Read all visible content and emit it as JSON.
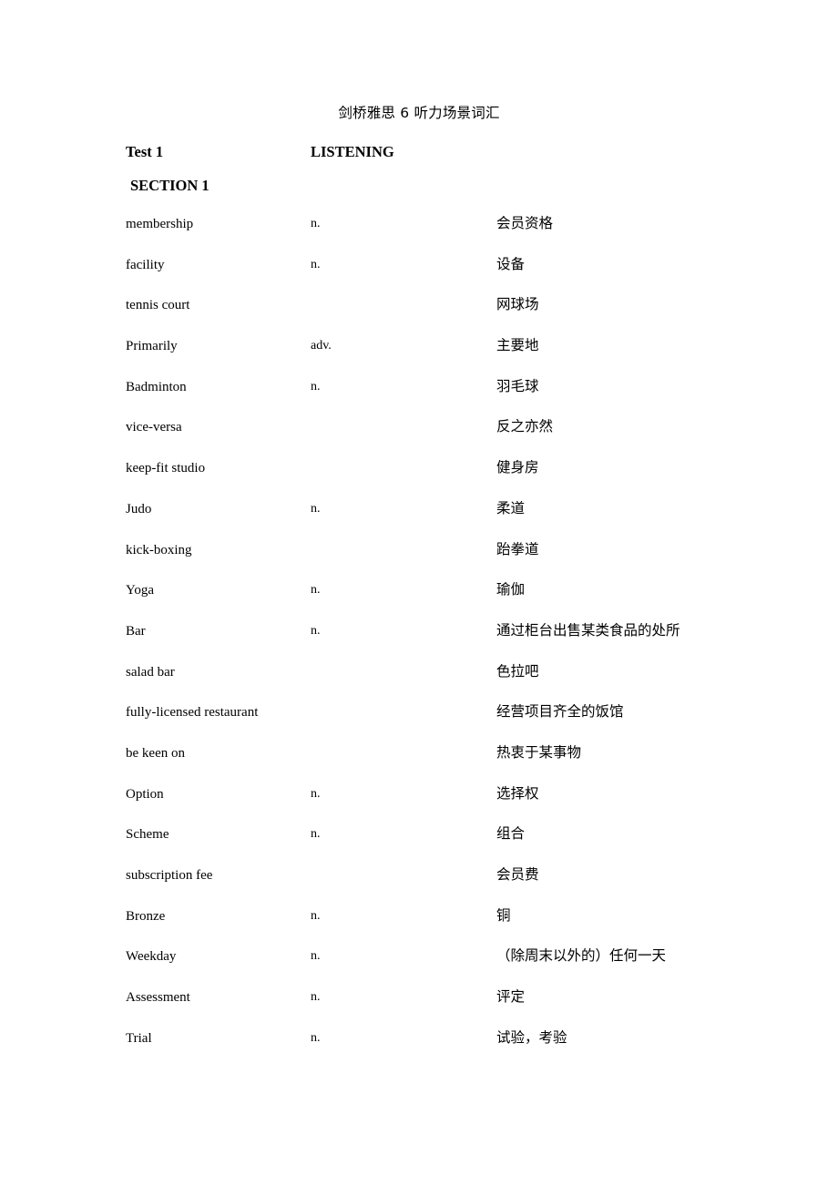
{
  "document": {
    "title": "剑桥雅思 6 听力场景词汇",
    "heading": {
      "test_label": "Test 1",
      "listening_label": "LISTENING",
      "section_label": "SECTION 1"
    },
    "entries": [
      {
        "term": "membership",
        "pos": "n.",
        "meaning": "会员资格"
      },
      {
        "term": "facility",
        "pos": "n.",
        "meaning": "设备"
      },
      {
        "term": "tennis court",
        "pos": "",
        "meaning": "网球场"
      },
      {
        "term": "Primarily",
        "pos": "adv.",
        "meaning": "主要地"
      },
      {
        "term": "Badminton",
        "pos": "n.",
        "meaning": "羽毛球"
      },
      {
        "term": "vice-versa",
        "pos": "",
        "meaning": "反之亦然"
      },
      {
        "term": "keep-fit studio",
        "pos": "",
        "meaning": "健身房"
      },
      {
        "term": "Judo",
        "pos": "n.",
        "meaning": "柔道"
      },
      {
        "term": "kick-boxing",
        "pos": "",
        "meaning": "跆拳道"
      },
      {
        "term": "Yoga",
        "pos": "n.",
        "meaning": "瑜伽"
      },
      {
        "term": "Bar",
        "pos": "n.",
        "meaning": "通过柜台出售某类食品的处所"
      },
      {
        "term": "salad bar",
        "pos": "",
        "meaning": "色拉吧"
      },
      {
        "term": "fully-licensed restaurant",
        "pos": "",
        "meaning": "经营项目齐全的饭馆"
      },
      {
        "term": "be keen on",
        "pos": "",
        "meaning": "热衷于某事物"
      },
      {
        "term": "Option",
        "pos": "n.",
        "meaning": "选择权"
      },
      {
        "term": "Scheme",
        "pos": "n.",
        "meaning": "组合"
      },
      {
        "term": "subscription fee",
        "pos": "",
        "meaning": "会员费"
      },
      {
        "term": "Bronze",
        "pos": "n.",
        "meaning": "铜"
      },
      {
        "term": "Weekday",
        "pos": "n.",
        "meaning": "（除周末以外的）任何一天"
      },
      {
        "term": "Assessment",
        "pos": "n.",
        "meaning": "评定"
      },
      {
        "term": "Trial",
        "pos": "n.",
        "meaning": "试验，考验"
      }
    ]
  }
}
